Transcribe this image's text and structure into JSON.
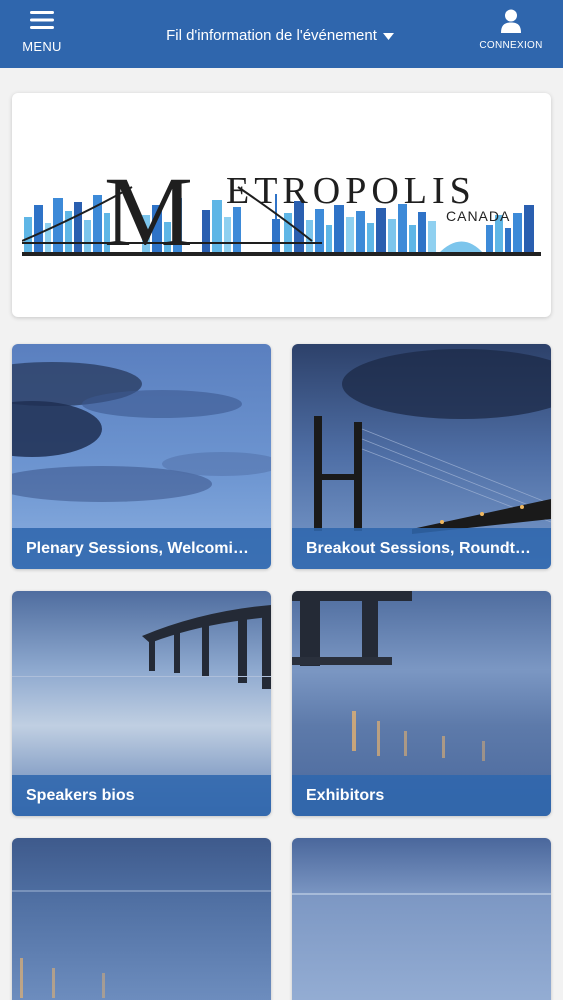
{
  "header": {
    "menu_label": "MENU",
    "feed_title": "Fil d'information de l'événement",
    "login_label": "CONNEXION"
  },
  "banner": {
    "logo_initial": "M",
    "logo_text": "ETROPOLIS",
    "logo_subtitle": "CANADA"
  },
  "tiles": [
    {
      "label": "Plenary Sessions, Welcoming Remarks"
    },
    {
      "label": "Breakout Sessions, Roundtables"
    },
    {
      "label": "Speakers bios"
    },
    {
      "label": "Exhibitors"
    },
    {
      "label": ""
    },
    {
      "label": ""
    }
  ],
  "colors": {
    "header_bg": "#2f66ad",
    "caption_bg": "#2f66ad",
    "page_bg": "#f2f2f2"
  },
  "icons": {
    "menu": "hamburger-icon",
    "dropdown": "caret-down-icon",
    "login": "user-icon"
  }
}
